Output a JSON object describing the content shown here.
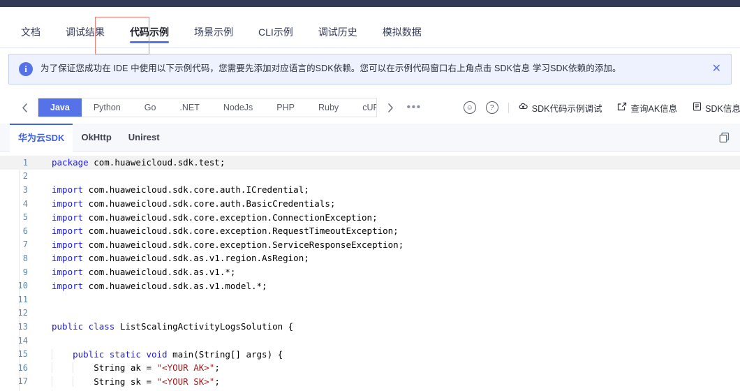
{
  "main_tabs": [
    {
      "label": "文档",
      "active": false
    },
    {
      "label": "调试结果",
      "active": false
    },
    {
      "label": "代码示例",
      "active": true
    },
    {
      "label": "场景示例",
      "active": false
    },
    {
      "label": "CLI示例",
      "active": false
    },
    {
      "label": "调试历史",
      "active": false
    },
    {
      "label": "模拟数据",
      "active": false
    }
  ],
  "banner": {
    "icon": "info-icon",
    "text": "为了保证您成功在 IDE 中使用以下示例代码，您需要先添加对应语言的SDK依赖。您可以在示例代码窗口右上角点击 SDK信息 学习SDK依赖的添加。",
    "close_label": "✕"
  },
  "langbar": {
    "prev_label": "‹",
    "next_label": "›",
    "more_label": "•••",
    "languages": [
      {
        "label": "Java",
        "active": true
      },
      {
        "label": "Python",
        "active": false
      },
      {
        "label": "Go",
        "active": false
      },
      {
        "label": ".NET",
        "active": false
      },
      {
        "label": "NodeJs",
        "active": false
      },
      {
        "label": "PHP",
        "active": false
      },
      {
        "label": "Ruby",
        "active": false
      },
      {
        "label": "cURL",
        "active": false
      }
    ],
    "smiley_label": "☺",
    "help_label": "?",
    "tools": [
      {
        "label": "SDK代码示例调试",
        "icon": "cloud-debug-icon"
      },
      {
        "label": "查询AK信息",
        "icon": "external-link-icon"
      },
      {
        "label": "SDK信息",
        "icon": "document-icon"
      }
    ]
  },
  "sdk_tabs": [
    {
      "label": "华为云SDK",
      "active": true
    },
    {
      "label": "OkHttp",
      "active": false
    },
    {
      "label": "Unirest",
      "active": false
    }
  ],
  "copy_icon": "copy-icon",
  "code": {
    "language": "Java",
    "lines": [
      {
        "n": 1,
        "highlight": true,
        "indent": 0,
        "parts": [
          {
            "t": "package",
            "c": "kw"
          },
          {
            "t": " com.huaweicloud.sdk.test;",
            "c": ""
          }
        ]
      },
      {
        "n": 2,
        "highlight": false,
        "indent": 0,
        "parts": []
      },
      {
        "n": 3,
        "highlight": false,
        "indent": 0,
        "parts": [
          {
            "t": "import",
            "c": "kw"
          },
          {
            "t": " com.huaweicloud.sdk.core.auth.ICredential;",
            "c": ""
          }
        ]
      },
      {
        "n": 4,
        "highlight": false,
        "indent": 0,
        "parts": [
          {
            "t": "import",
            "c": "kw"
          },
          {
            "t": " com.huaweicloud.sdk.core.auth.BasicCredentials;",
            "c": ""
          }
        ]
      },
      {
        "n": 5,
        "highlight": false,
        "indent": 0,
        "parts": [
          {
            "t": "import",
            "c": "kw"
          },
          {
            "t": " com.huaweicloud.sdk.core.exception.ConnectionException;",
            "c": ""
          }
        ]
      },
      {
        "n": 6,
        "highlight": false,
        "indent": 0,
        "parts": [
          {
            "t": "import",
            "c": "kw"
          },
          {
            "t": " com.huaweicloud.sdk.core.exception.RequestTimeoutException;",
            "c": ""
          }
        ]
      },
      {
        "n": 7,
        "highlight": false,
        "indent": 0,
        "parts": [
          {
            "t": "import",
            "c": "kw"
          },
          {
            "t": " com.huaweicloud.sdk.core.exception.ServiceResponseException;",
            "c": ""
          }
        ]
      },
      {
        "n": 8,
        "highlight": false,
        "indent": 0,
        "parts": [
          {
            "t": "import",
            "c": "kw"
          },
          {
            "t": " com.huaweicloud.sdk.as.v1.region.AsRegion;",
            "c": ""
          }
        ]
      },
      {
        "n": 9,
        "highlight": false,
        "indent": 0,
        "parts": [
          {
            "t": "import",
            "c": "kw"
          },
          {
            "t": " com.huaweicloud.sdk.as.v1.*;",
            "c": ""
          }
        ]
      },
      {
        "n": 10,
        "highlight": false,
        "indent": 0,
        "parts": [
          {
            "t": "import",
            "c": "kw"
          },
          {
            "t": " com.huaweicloud.sdk.as.v1.model.*;",
            "c": ""
          }
        ]
      },
      {
        "n": 11,
        "highlight": false,
        "indent": 0,
        "parts": []
      },
      {
        "n": 12,
        "highlight": false,
        "indent": 0,
        "parts": []
      },
      {
        "n": 13,
        "highlight": false,
        "indent": 0,
        "parts": [
          {
            "t": "public class",
            "c": "kw"
          },
          {
            "t": " ListScalingActivityLogsSolution {",
            "c": ""
          }
        ]
      },
      {
        "n": 14,
        "highlight": false,
        "indent": 1,
        "parts": []
      },
      {
        "n": 15,
        "highlight": false,
        "indent": 1,
        "parts": [
          {
            "t": "    ",
            "c": ""
          },
          {
            "t": "public static void",
            "c": "kw"
          },
          {
            "t": " main(String[] args) {",
            "c": ""
          }
        ]
      },
      {
        "n": 16,
        "highlight": false,
        "indent": 2,
        "parts": [
          {
            "t": "        String ak = ",
            "c": ""
          },
          {
            "t": "\"<YOUR AK>\"",
            "c": "str"
          },
          {
            "t": ";",
            "c": ""
          }
        ]
      },
      {
        "n": 17,
        "highlight": false,
        "indent": 2,
        "parts": [
          {
            "t": "        String sk = ",
            "c": ""
          },
          {
            "t": "\"<YOUR SK>\"",
            "c": "str"
          },
          {
            "t": ";",
            "c": ""
          }
        ]
      }
    ]
  },
  "colors": {
    "topbar": "#333a56",
    "accent": "#5572e8",
    "sdk_active": "#3d62e3",
    "banner_bg": "#eef2fe",
    "annotation": "#f57a72",
    "keyword": "#1a1ae6",
    "string": "#9b1d1d",
    "linenum": "#5f87a8"
  }
}
